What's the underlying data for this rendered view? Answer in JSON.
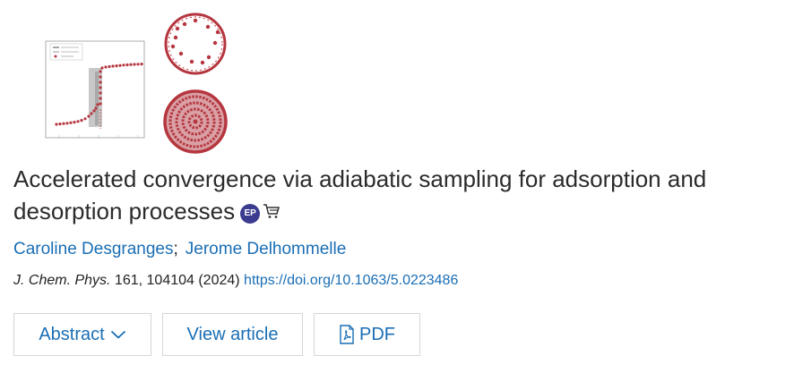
{
  "article": {
    "title": "Accelerated convergence via adiabatic sampling for adsorption and desorption processes",
    "badge": "EP",
    "authors": [
      "Caroline Desgranges",
      "Jerome Delhommelle"
    ],
    "author_separator": ";",
    "journal": "J. Chem. Phys.",
    "citation_rest": " 161, 104104 (2024) ",
    "doi": "https://doi.org/10.1063/5.0223486"
  },
  "actions": {
    "abstract_label": "Abstract",
    "view_label": "View article",
    "pdf_label": "PDF"
  },
  "colors": {
    "link": "#1a6eb4",
    "badge": "#3b3b8f",
    "dots": "#b5363f"
  },
  "icons": [
    "ep-badge-icon",
    "cart-icon",
    "chevron-down-icon",
    "pdf-icon"
  ]
}
